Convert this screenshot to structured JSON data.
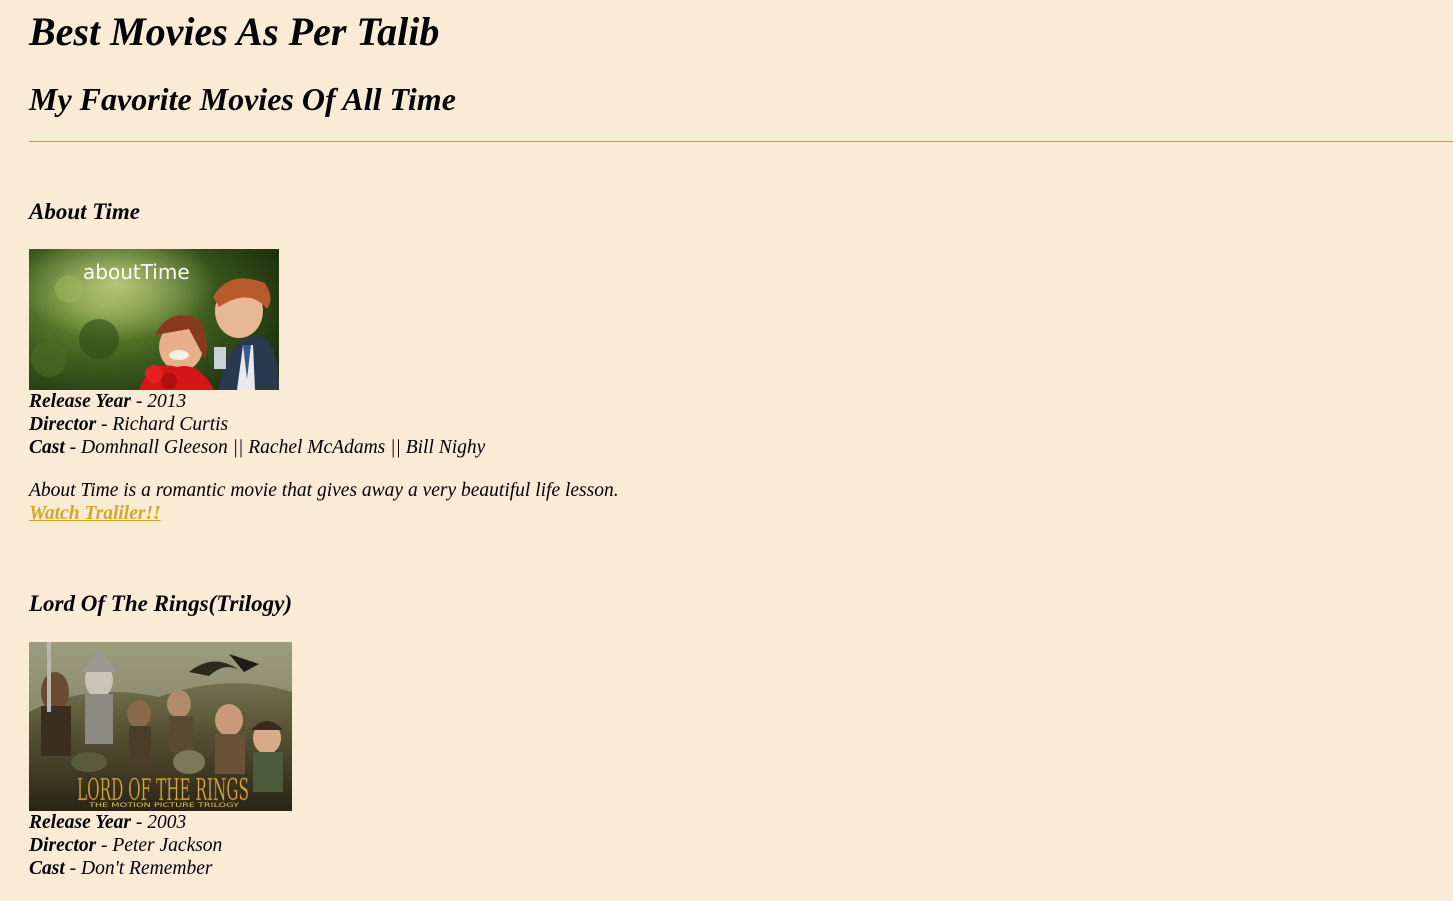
{
  "page": {
    "title": "Best Movies As Per Talib",
    "subtitle": "My Favorite Movies Of All Time"
  },
  "movies": [
    {
      "title": "About Time",
      "poster_text": "aboutTime",
      "release_label": "Release Year",
      "release_value": " - 2013",
      "director_label": "Director",
      "director_value": " - Richard Curtis",
      "cast_label": "Cast",
      "cast_value": " - Domhnall Gleeson || Rachel McAdams || Bill Nighy",
      "description": "About Time is a romantic movie that gives away a very beautiful life lesson.",
      "trailer_link": "Watch Traliler!!"
    },
    {
      "title": "Lord Of The Rings(Trilogy)",
      "poster_text_top": "THE",
      "poster_text_main": "LORD OF THE RINGS",
      "poster_text_sub": "THE MOTION PICTURE TRILOGY",
      "release_label": "Release Year",
      "release_value": " - 2003",
      "director_label": "Director",
      "director_value": " - Peter Jackson",
      "cast_label": "Cast",
      "cast_value": " - Don't Remember"
    }
  ],
  "colors": {
    "background": "#faebd7",
    "link": "#d4a72c",
    "rule": "#9a9aa4"
  }
}
